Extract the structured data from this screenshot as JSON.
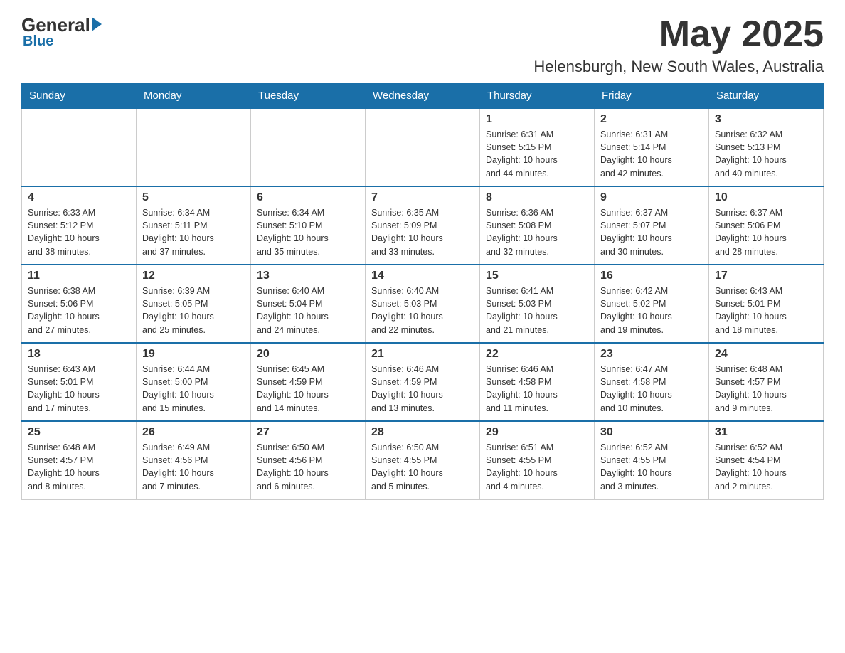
{
  "header": {
    "logo_general": "General",
    "logo_blue": "Blue",
    "month_title": "May 2025",
    "location": "Helensburgh, New South Wales, Australia"
  },
  "weekdays": [
    "Sunday",
    "Monday",
    "Tuesday",
    "Wednesday",
    "Thursday",
    "Friday",
    "Saturday"
  ],
  "weeks": [
    {
      "days": [
        {
          "num": "",
          "info": ""
        },
        {
          "num": "",
          "info": ""
        },
        {
          "num": "",
          "info": ""
        },
        {
          "num": "",
          "info": ""
        },
        {
          "num": "1",
          "info": "Sunrise: 6:31 AM\nSunset: 5:15 PM\nDaylight: 10 hours\nand 44 minutes."
        },
        {
          "num": "2",
          "info": "Sunrise: 6:31 AM\nSunset: 5:14 PM\nDaylight: 10 hours\nand 42 minutes."
        },
        {
          "num": "3",
          "info": "Sunrise: 6:32 AM\nSunset: 5:13 PM\nDaylight: 10 hours\nand 40 minutes."
        }
      ]
    },
    {
      "days": [
        {
          "num": "4",
          "info": "Sunrise: 6:33 AM\nSunset: 5:12 PM\nDaylight: 10 hours\nand 38 minutes."
        },
        {
          "num": "5",
          "info": "Sunrise: 6:34 AM\nSunset: 5:11 PM\nDaylight: 10 hours\nand 37 minutes."
        },
        {
          "num": "6",
          "info": "Sunrise: 6:34 AM\nSunset: 5:10 PM\nDaylight: 10 hours\nand 35 minutes."
        },
        {
          "num": "7",
          "info": "Sunrise: 6:35 AM\nSunset: 5:09 PM\nDaylight: 10 hours\nand 33 minutes."
        },
        {
          "num": "8",
          "info": "Sunrise: 6:36 AM\nSunset: 5:08 PM\nDaylight: 10 hours\nand 32 minutes."
        },
        {
          "num": "9",
          "info": "Sunrise: 6:37 AM\nSunset: 5:07 PM\nDaylight: 10 hours\nand 30 minutes."
        },
        {
          "num": "10",
          "info": "Sunrise: 6:37 AM\nSunset: 5:06 PM\nDaylight: 10 hours\nand 28 minutes."
        }
      ]
    },
    {
      "days": [
        {
          "num": "11",
          "info": "Sunrise: 6:38 AM\nSunset: 5:06 PM\nDaylight: 10 hours\nand 27 minutes."
        },
        {
          "num": "12",
          "info": "Sunrise: 6:39 AM\nSunset: 5:05 PM\nDaylight: 10 hours\nand 25 minutes."
        },
        {
          "num": "13",
          "info": "Sunrise: 6:40 AM\nSunset: 5:04 PM\nDaylight: 10 hours\nand 24 minutes."
        },
        {
          "num": "14",
          "info": "Sunrise: 6:40 AM\nSunset: 5:03 PM\nDaylight: 10 hours\nand 22 minutes."
        },
        {
          "num": "15",
          "info": "Sunrise: 6:41 AM\nSunset: 5:03 PM\nDaylight: 10 hours\nand 21 minutes."
        },
        {
          "num": "16",
          "info": "Sunrise: 6:42 AM\nSunset: 5:02 PM\nDaylight: 10 hours\nand 19 minutes."
        },
        {
          "num": "17",
          "info": "Sunrise: 6:43 AM\nSunset: 5:01 PM\nDaylight: 10 hours\nand 18 minutes."
        }
      ]
    },
    {
      "days": [
        {
          "num": "18",
          "info": "Sunrise: 6:43 AM\nSunset: 5:01 PM\nDaylight: 10 hours\nand 17 minutes."
        },
        {
          "num": "19",
          "info": "Sunrise: 6:44 AM\nSunset: 5:00 PM\nDaylight: 10 hours\nand 15 minutes."
        },
        {
          "num": "20",
          "info": "Sunrise: 6:45 AM\nSunset: 4:59 PM\nDaylight: 10 hours\nand 14 minutes."
        },
        {
          "num": "21",
          "info": "Sunrise: 6:46 AM\nSunset: 4:59 PM\nDaylight: 10 hours\nand 13 minutes."
        },
        {
          "num": "22",
          "info": "Sunrise: 6:46 AM\nSunset: 4:58 PM\nDaylight: 10 hours\nand 11 minutes."
        },
        {
          "num": "23",
          "info": "Sunrise: 6:47 AM\nSunset: 4:58 PM\nDaylight: 10 hours\nand 10 minutes."
        },
        {
          "num": "24",
          "info": "Sunrise: 6:48 AM\nSunset: 4:57 PM\nDaylight: 10 hours\nand 9 minutes."
        }
      ]
    },
    {
      "days": [
        {
          "num": "25",
          "info": "Sunrise: 6:48 AM\nSunset: 4:57 PM\nDaylight: 10 hours\nand 8 minutes."
        },
        {
          "num": "26",
          "info": "Sunrise: 6:49 AM\nSunset: 4:56 PM\nDaylight: 10 hours\nand 7 minutes."
        },
        {
          "num": "27",
          "info": "Sunrise: 6:50 AM\nSunset: 4:56 PM\nDaylight: 10 hours\nand 6 minutes."
        },
        {
          "num": "28",
          "info": "Sunrise: 6:50 AM\nSunset: 4:55 PM\nDaylight: 10 hours\nand 5 minutes."
        },
        {
          "num": "29",
          "info": "Sunrise: 6:51 AM\nSunset: 4:55 PM\nDaylight: 10 hours\nand 4 minutes."
        },
        {
          "num": "30",
          "info": "Sunrise: 6:52 AM\nSunset: 4:55 PM\nDaylight: 10 hours\nand 3 minutes."
        },
        {
          "num": "31",
          "info": "Sunrise: 6:52 AM\nSunset: 4:54 PM\nDaylight: 10 hours\nand 2 minutes."
        }
      ]
    }
  ]
}
